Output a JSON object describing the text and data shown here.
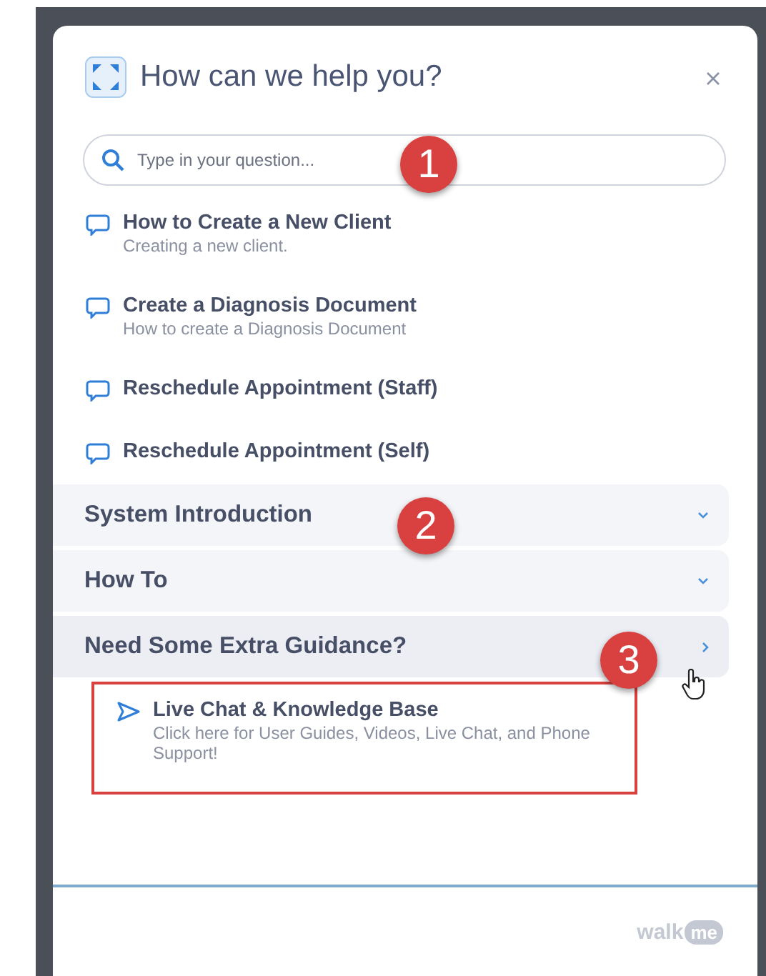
{
  "dialog": {
    "title": "How can we help you?",
    "search": {
      "placeholder": "Type in your question..."
    },
    "articles": [
      {
        "title": "How to Create a New Client",
        "subtitle": "Creating a new client."
      },
      {
        "title": "Create a Diagnosis Document",
        "subtitle": "How to create a Diagnosis Document"
      },
      {
        "title": "Reschedule Appointment (Staff)"
      },
      {
        "title": "Reschedule Appointment (Self)"
      }
    ],
    "sections": [
      {
        "label": "System Introduction",
        "expanded": false
      },
      {
        "label": "How To",
        "expanded": false
      },
      {
        "label": "Need Some Extra Guidance?",
        "expanded": true,
        "items": [
          {
            "title": "Live Chat & Knowledge Base",
            "subtitle": "Click here for User Guides, Videos, Live Chat, and Phone Support!",
            "highlighted": true
          }
        ]
      }
    ],
    "footer": {
      "logo": [
        "walk",
        "me"
      ]
    }
  },
  "annotations": [
    {
      "number": "1"
    },
    {
      "number": "2"
    },
    {
      "number": "3"
    }
  ]
}
